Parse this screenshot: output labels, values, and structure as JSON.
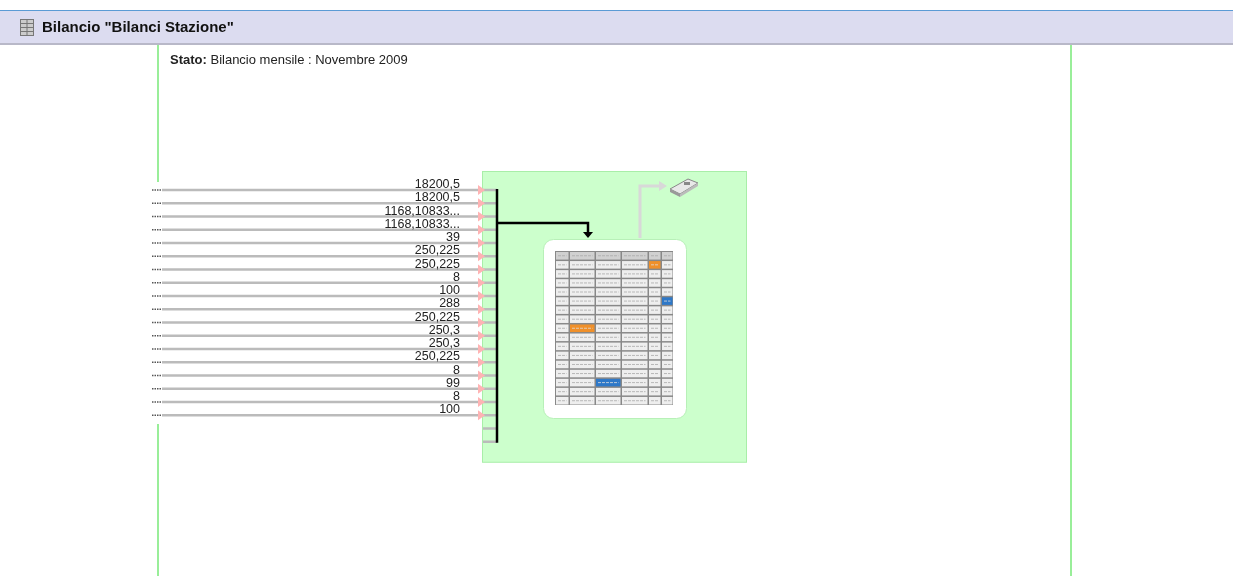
{
  "header": {
    "title": "Bilancio \"Bilanci Stazione\""
  },
  "status": "**Stato:** Bilancio mensile : Novembre 2009",
  "input_values": [
    "18200,5",
    "18200,5",
    "1168,10833...",
    "1168,10833...",
    "39",
    "250,225",
    "250,225",
    "8",
    "100",
    "288",
    "250,225",
    "250,3",
    "250,3",
    "250,225",
    "8",
    "99",
    "8",
    "100"
  ]
}
